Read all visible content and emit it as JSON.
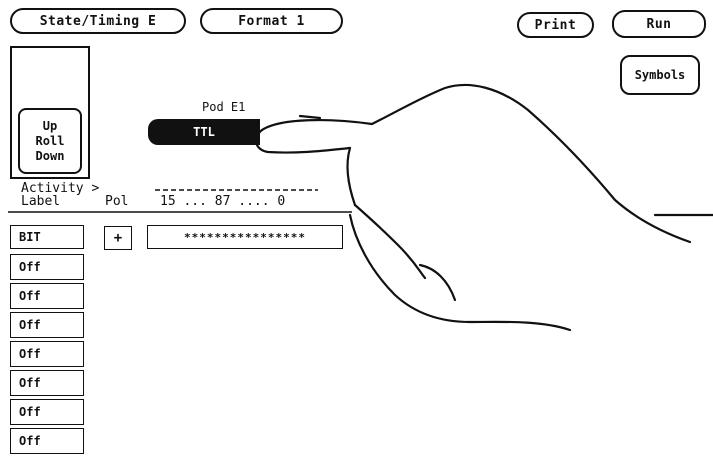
{
  "header": {
    "state_timing_label": "State/Timing E",
    "format_label": "Format 1",
    "print_label": "Print",
    "run_label": "Run",
    "symbols_label": "Symbols"
  },
  "roll": {
    "line1": "Up",
    "line2": "Roll",
    "line3": "Down"
  },
  "pod": {
    "title": "Pod E1",
    "threshold": "TTL"
  },
  "columns": {
    "activity": "Activity >",
    "label": "Label",
    "pol": "Pol",
    "bits": "15 ... 87 .... 0"
  },
  "first_row": {
    "label": "BIT",
    "polarity": "+",
    "assignment": "****************"
  },
  "rows": [
    "Off",
    "Off",
    "Off",
    "Off",
    "Off",
    "Off",
    "Off"
  ]
}
